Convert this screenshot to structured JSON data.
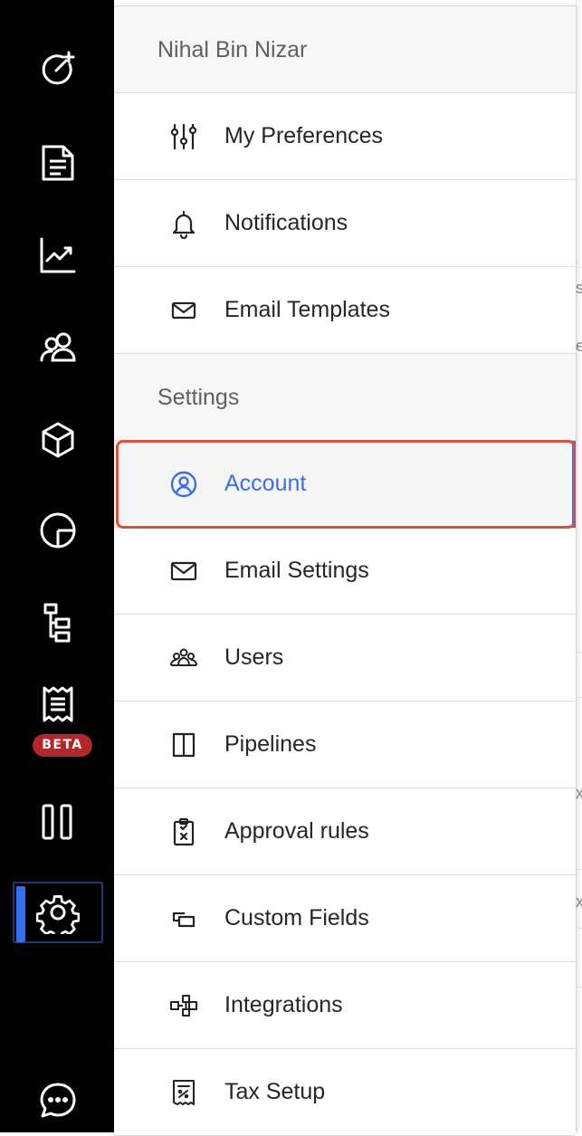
{
  "rail": {
    "items": [
      {
        "icon": "speedometer-icon"
      },
      {
        "icon": "document-icon"
      },
      {
        "icon": "chart-line-icon"
      },
      {
        "icon": "contacts-icon"
      },
      {
        "icon": "box-icon"
      },
      {
        "icon": "pie-chart-icon"
      },
      {
        "icon": "hierarchy-icon"
      },
      {
        "icon": "receipt-icon",
        "badge": "BETA"
      },
      {
        "icon": "columns-icon"
      },
      {
        "icon": "gear-icon",
        "active": true
      },
      {
        "icon": "chat-icon"
      }
    ],
    "active_color": "#2f6ff0",
    "beta_color": "#b3262c"
  },
  "panel": {
    "user_name": "Nihal Bin Nizar",
    "personal_items": [
      {
        "label": "My Preferences",
        "icon": "sliders-icon"
      },
      {
        "label": "Notifications",
        "icon": "bell-icon"
      },
      {
        "label": "Email Templates",
        "icon": "envelope-icon"
      }
    ],
    "settings_header": "Settings",
    "settings_items": [
      {
        "label": "Account",
        "icon": "user-circle-icon",
        "selected": true
      },
      {
        "label": "Email Settings",
        "icon": "envelope-icon"
      },
      {
        "label": "Users",
        "icon": "users-icon"
      },
      {
        "label": "Pipelines",
        "icon": "columns-icon"
      },
      {
        "label": "Approval rules",
        "icon": "clipboard-icon"
      },
      {
        "label": "Custom Fields",
        "icon": "custom-fields-icon"
      },
      {
        "label": "Integrations",
        "icon": "integrations-icon"
      },
      {
        "label": "Tax Setup",
        "icon": "tax-icon"
      }
    ],
    "selected_color": "#3a6fe8",
    "highlight_color": "#d9503f"
  },
  "background": {
    "edge_chars": [
      "s",
      "e",
      "x",
      "x"
    ]
  }
}
